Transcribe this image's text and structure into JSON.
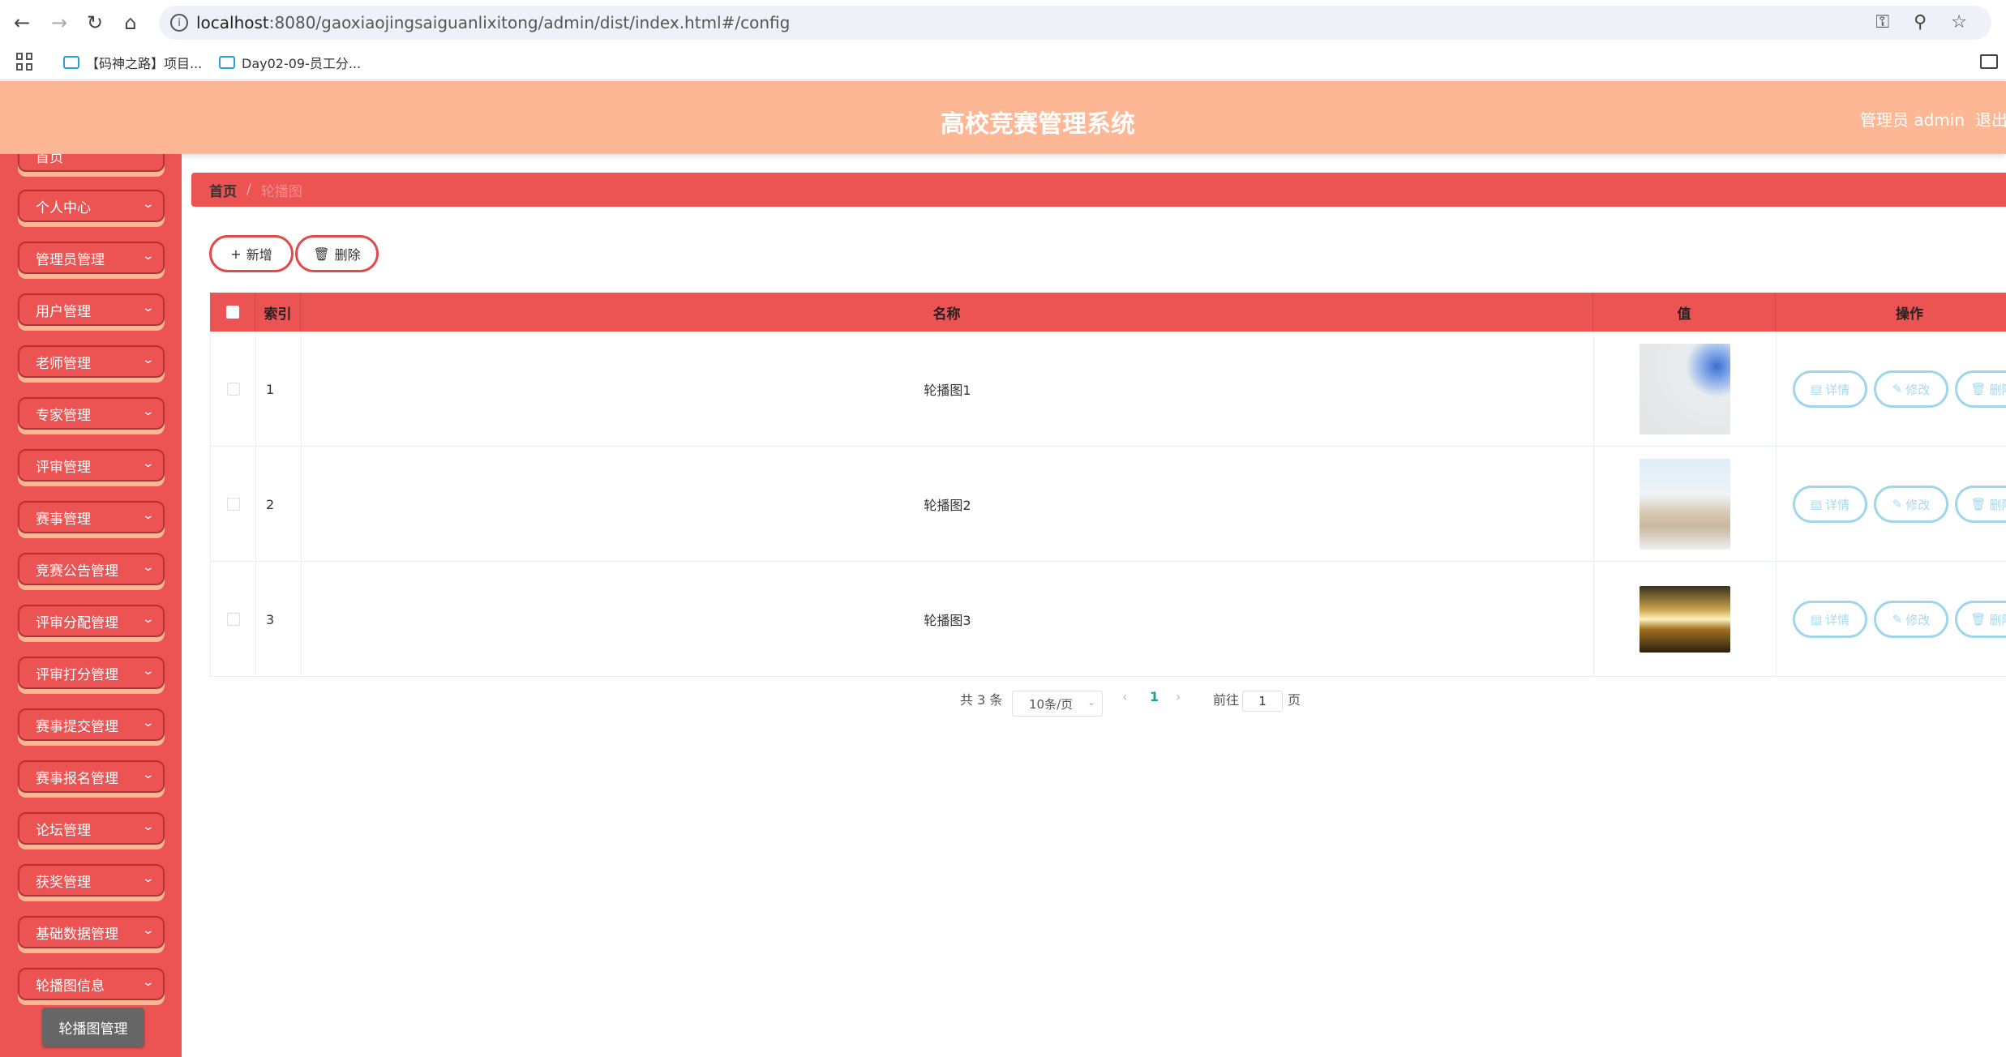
{
  "browser": {
    "url_host": "localhost",
    "url_path": ":8080/gaoxiaojingsaiguanlixitong/admin/dist/index.html#/config",
    "bookmarks": [
      {
        "label": "【码神之路】项目..."
      },
      {
        "label": "Day02-09-员工分..."
      }
    ]
  },
  "header": {
    "title": "高校竞赛管理系统",
    "user": "管理员 admin",
    "logout": "退出"
  },
  "sidebar": {
    "items": [
      {
        "label": "首页"
      },
      {
        "label": "个人中心"
      },
      {
        "label": "管理员管理"
      },
      {
        "label": "用户管理"
      },
      {
        "label": "老师管理"
      },
      {
        "label": "专家管理"
      },
      {
        "label": "评审管理"
      },
      {
        "label": "赛事管理"
      },
      {
        "label": "竞赛公告管理"
      },
      {
        "label": "评审分配管理"
      },
      {
        "label": "评审打分管理"
      },
      {
        "label": "赛事提交管理"
      },
      {
        "label": "赛事报名管理"
      },
      {
        "label": "论坛管理"
      },
      {
        "label": "获奖管理"
      },
      {
        "label": "基础数据管理"
      },
      {
        "label": "轮播图信息"
      }
    ],
    "sub_item": "轮播图管理"
  },
  "breadcrumb": {
    "home": "首页",
    "separator": "/",
    "current": "轮播图"
  },
  "toolbar": {
    "add_label": "新增",
    "delete_label": "删除"
  },
  "table": {
    "headers": {
      "index": "索引",
      "name": "名称",
      "value": "值",
      "ops": "操作"
    },
    "rows": [
      {
        "index": "1",
        "name": "轮播图1"
      },
      {
        "index": "2",
        "name": "轮播图2"
      },
      {
        "index": "3",
        "name": "轮播图3"
      }
    ],
    "ops": {
      "detail": "详情",
      "edit": "修改",
      "delete": "删除"
    }
  },
  "pagination": {
    "total": "共 3 条",
    "page_size": "10条/页",
    "current_page": "1",
    "goto_label": "前往",
    "goto_value": "1",
    "page_suffix": "页"
  },
  "colors": {
    "header_bg": "#fdb794",
    "sidebar_bg": "#ec5454",
    "accent": "#ec5454",
    "op_button": "#9fd6ec",
    "active_page": "#1aa094"
  }
}
